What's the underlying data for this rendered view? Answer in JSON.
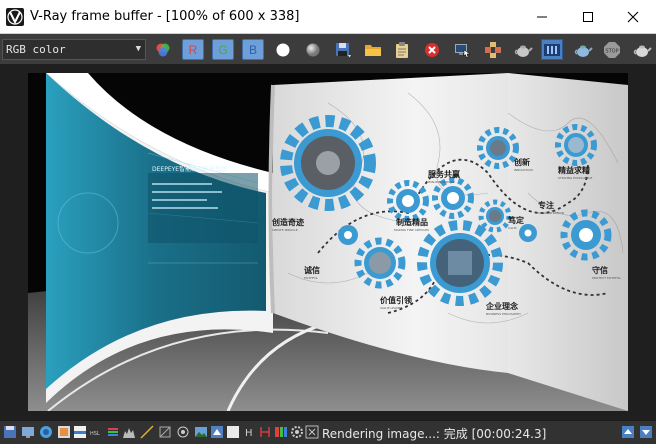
{
  "window": {
    "title": "V-Ray frame buffer - [100% of 600 x 338]"
  },
  "toolbar": {
    "channel_value": "RGB color",
    "red_label": "R",
    "green_label": "G",
    "blue_label": "B"
  },
  "status": {
    "text": "Rendering image...: 完成 [00:00:24.3]"
  },
  "render": {
    "title_text": "DEEPEYE智能辅助驾驶系统",
    "gear_labels": [
      "创造奇迹",
      "制造精品",
      "服务共赢",
      "创新",
      "精益求精",
      "专注",
      "笃定",
      "诚信",
      "价值引领",
      "企业理念",
      "守信"
    ],
    "gear_sublabels": [
      "CREATE MIRACLE",
      "MAKING FINE ARTICLES",
      "WIN-WIN SERVICE",
      "INNOVATION",
      "STRIVING EXCELLENCE",
      "CONCENTRATION",
      "CALM",
      "FAITHFUL",
      "VALUE LEADER",
      "BUSINESS PHILOSOPHY",
      "PROTECT FAITHFUL"
    ]
  },
  "colors": {
    "accent_blue": "#3a9ad1",
    "toolbar_bg": "#3c3c3c",
    "screen_teal": "#1d7c96"
  }
}
